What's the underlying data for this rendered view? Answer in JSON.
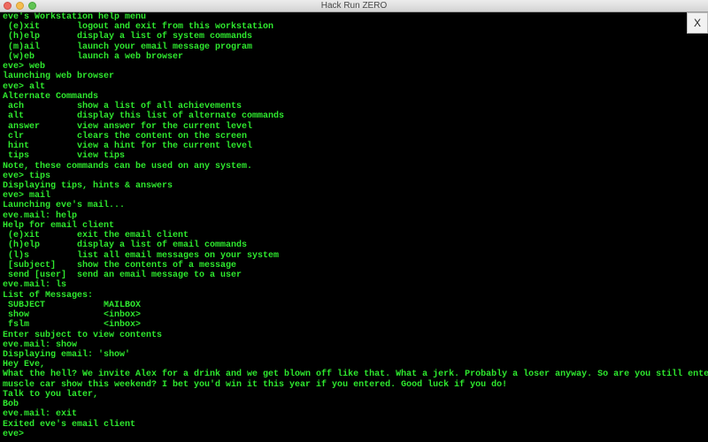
{
  "window": {
    "title": "Hack Run ZERO",
    "close_button_label": "X"
  },
  "terminal": {
    "lines": [
      {
        "type": "text",
        "text": "eve's Workstation help menu"
      },
      {
        "type": "cmd",
        "c1": " (e)xit",
        "c2": "logout and exit from this workstation"
      },
      {
        "type": "cmd",
        "c1": " (h)elp",
        "c2": "display a list of system commands"
      },
      {
        "type": "cmd",
        "c1": " (m)ail",
        "c2": "launch your email message program"
      },
      {
        "type": "cmd",
        "c1": " (w)eb",
        "c2": "launch a web browser"
      },
      {
        "type": "text",
        "text": "eve> web"
      },
      {
        "type": "text",
        "text": "launching web browser"
      },
      {
        "type": "text",
        "text": "eve> alt"
      },
      {
        "type": "text",
        "text": "Alternate Commands"
      },
      {
        "type": "cmd",
        "c1": " ach",
        "c2": "show a list of all achievements"
      },
      {
        "type": "cmd",
        "c1": " alt",
        "c2": "display this list of alternate commands"
      },
      {
        "type": "cmd",
        "c1": " answer",
        "c2": "view answer for the current level"
      },
      {
        "type": "cmd",
        "c1": " clr",
        "c2": "clears the content on the screen"
      },
      {
        "type": "cmd",
        "c1": " hint",
        "c2": "view a hint for the current level"
      },
      {
        "type": "cmd",
        "c1": " tips",
        "c2": "view tips"
      },
      {
        "type": "text",
        "text": "Note, these commands can be used on any system."
      },
      {
        "type": "text",
        "text": "eve> tips"
      },
      {
        "type": "text",
        "text": "Displaying tips, hints & answers"
      },
      {
        "type": "text",
        "text": "eve> mail"
      },
      {
        "type": "text",
        "text": "Launching eve's mail..."
      },
      {
        "type": "text",
        "text": "eve.mail: help"
      },
      {
        "type": "text",
        "text": "Help for email client"
      },
      {
        "type": "cmd",
        "c1": " (e)xit",
        "c2": "exit the email client"
      },
      {
        "type": "cmd",
        "c1": " (h)elp",
        "c2": "display a list of email commands"
      },
      {
        "type": "cmd",
        "c1": " (l)s",
        "c2": "list all email messages on your system"
      },
      {
        "type": "cmd",
        "c1": " [subject]",
        "c2": "show the contents of a message"
      },
      {
        "type": "cmd",
        "c1": " send [user]",
        "c2": "send an email message to a user"
      },
      {
        "type": "text",
        "text": "eve.mail: ls"
      },
      {
        "type": "text",
        "text": "List of Messages:"
      },
      {
        "type": "mail",
        "c1": " SUBJECT",
        "c2": "MAILBOX"
      },
      {
        "type": "mail",
        "c1": " show",
        "c2": "<inbox>"
      },
      {
        "type": "mail",
        "c1": " fslm",
        "c2": "<inbox>"
      },
      {
        "type": "text",
        "text": "Enter subject to view contents"
      },
      {
        "type": "text",
        "text": "eve.mail: show"
      },
      {
        "type": "text",
        "text": "Displaying email: 'show'"
      },
      {
        "type": "text",
        "text": "Hey Eve,"
      },
      {
        "type": "text",
        "text": "What the hell? We invite Alex for a drink and we get blown off like that. What a jerk. Probably a loser anyway. So are you still entering the"
      },
      {
        "type": "text",
        "text": "muscle car show this weekend? I bet you'd win it this year if you entered. Good luck if you do!"
      },
      {
        "type": "text",
        "text": "Talk to you later,"
      },
      {
        "type": "text",
        "text": "Bob"
      },
      {
        "type": "text",
        "text": "eve.mail: exit"
      },
      {
        "type": "text",
        "text": "Exited eve's email client"
      },
      {
        "type": "prompt",
        "text": "eve>"
      }
    ]
  },
  "colors": {
    "terminal_text": "#2ee82e",
    "terminal_bg": "#000000"
  }
}
